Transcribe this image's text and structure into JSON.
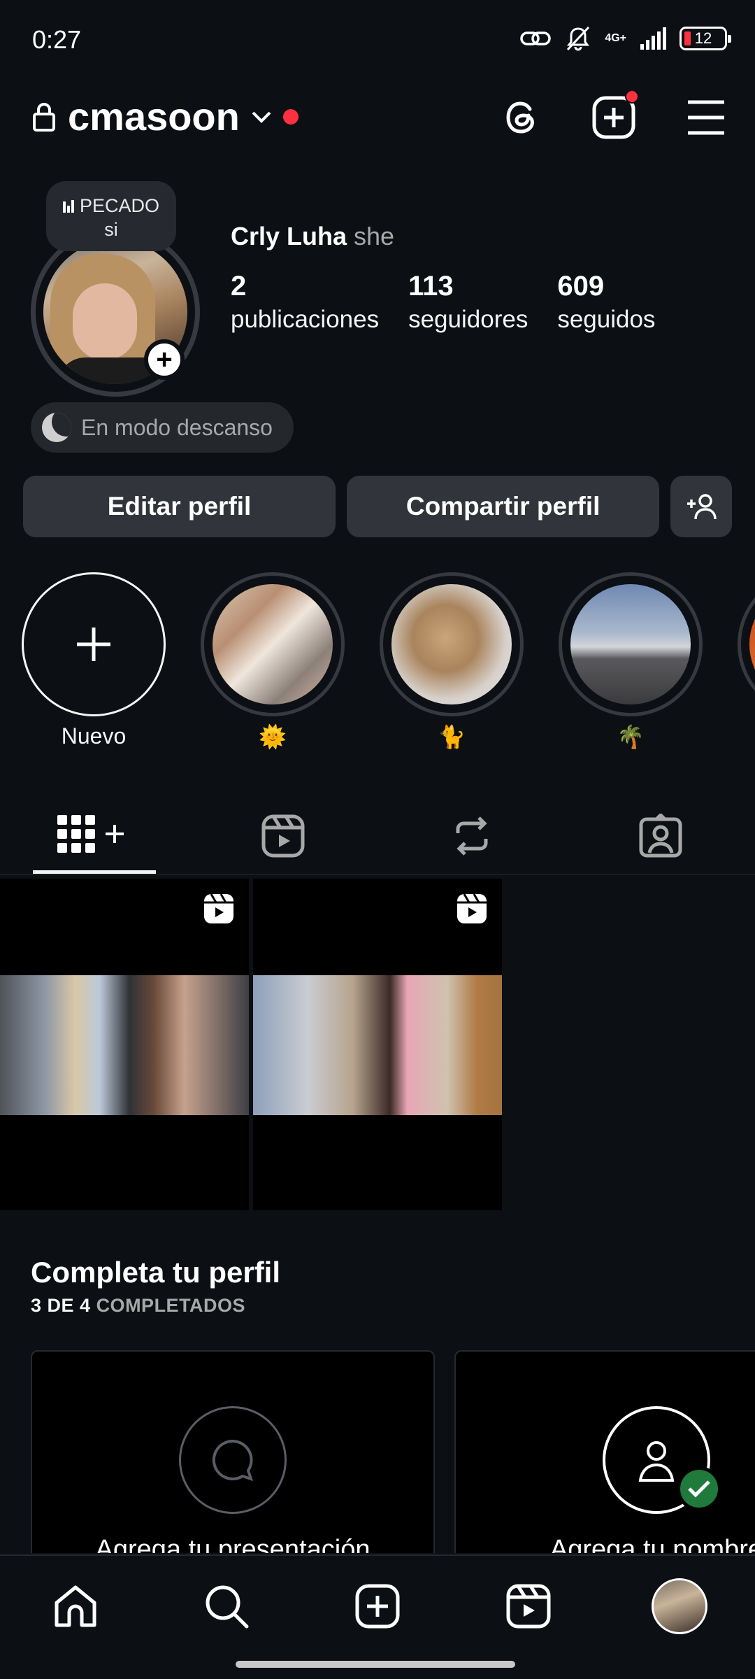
{
  "status_bar": {
    "time": "0:27",
    "network": "4G+",
    "battery": "12"
  },
  "header": {
    "username": "cmasoon"
  },
  "profile": {
    "note_line1": "PECADO",
    "note_line2": "si",
    "full_name": "Crly Luha",
    "pronouns": "she",
    "stats": [
      {
        "value": "2",
        "label": "publicaciones"
      },
      {
        "value": "113",
        "label": "seguidores"
      },
      {
        "value": "609",
        "label": "seguidos"
      }
    ],
    "rest_mode": "En modo descanso"
  },
  "actions": {
    "edit": "Editar perfil",
    "share": "Compartir perfil"
  },
  "highlights": [
    {
      "label": "Nuevo"
    },
    {
      "label": "🌞"
    },
    {
      "label": "🐈"
    },
    {
      "label": "🌴"
    }
  ],
  "complete_profile": {
    "title": "Completa tu perfil",
    "progress_strong": "3 DE 4",
    "progress_rest": "COMPLETADOS",
    "cards": [
      {
        "label": "Agrega tu presentación"
      },
      {
        "label": "Agrega tu nombre"
      }
    ]
  },
  "colors": {
    "background": "#0c1014",
    "accent_red": "#ff3040",
    "button_bg": "#31353b",
    "check_green": "#1f7a3c"
  },
  "icons": [
    "lock-icon",
    "chevron-down-icon",
    "threads-icon",
    "new-post-icon",
    "menu-icon",
    "grid-icon",
    "reels-icon",
    "reposts-icon",
    "tagged-icon",
    "home-icon",
    "search-icon",
    "create-icon"
  ]
}
